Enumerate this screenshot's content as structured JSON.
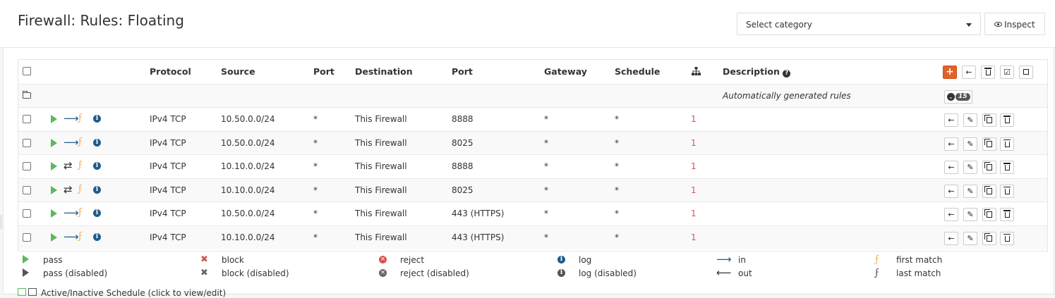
{
  "page": {
    "title": "Firewall: Rules: Floating"
  },
  "category_select": {
    "value": "Select category"
  },
  "inspect": {
    "label": "Inspect"
  },
  "columns": [
    "Protocol",
    "Source",
    "Port",
    "Destination",
    "Port",
    "Gateway",
    "Schedule",
    "Description"
  ],
  "auto_rules": {
    "description": "Automatically generated rules",
    "count": "15"
  },
  "rules": [
    {
      "direction": "in",
      "protocol": "IPv4 TCP",
      "source": "10.50.0.0/24",
      "src_port": "*",
      "destination": "This Firewall",
      "dst_port": "8888",
      "gateway": "*",
      "schedule": "*",
      "evaluations": "1",
      "description": ""
    },
    {
      "direction": "in",
      "protocol": "IPv4 TCP",
      "source": "10.50.0.0/24",
      "src_port": "*",
      "destination": "This Firewall",
      "dst_port": "8025",
      "gateway": "*",
      "schedule": "*",
      "evaluations": "1",
      "description": ""
    },
    {
      "direction": "both",
      "protocol": "IPv4 TCP",
      "source": "10.10.0.0/24",
      "src_port": "*",
      "destination": "This Firewall",
      "dst_port": "8888",
      "gateway": "*",
      "schedule": "*",
      "evaluations": "1",
      "description": ""
    },
    {
      "direction": "both",
      "protocol": "IPv4 TCP",
      "source": "10.10.0.0/24",
      "src_port": "*",
      "destination": "This Firewall",
      "dst_port": "8025",
      "gateway": "*",
      "schedule": "*",
      "evaluations": "1",
      "description": ""
    },
    {
      "direction": "in",
      "protocol": "IPv4 TCP",
      "source": "10.50.0.0/24",
      "src_port": "*",
      "destination": "This Firewall",
      "dst_port": "443 (HTTPS)",
      "gateway": "*",
      "schedule": "*",
      "evaluations": "1",
      "description": ""
    },
    {
      "direction": "in",
      "protocol": "IPv4 TCP",
      "source": "10.10.0.0/24",
      "src_port": "*",
      "destination": "This Firewall",
      "dst_port": "443 (HTTPS)",
      "gateway": "*",
      "schedule": "*",
      "evaluations": "1",
      "description": ""
    }
  ],
  "legend": {
    "pass": "pass",
    "pass_disabled": "pass (disabled)",
    "block": "block",
    "block_disabled": "block (disabled)",
    "reject": "reject",
    "reject_disabled": "reject (disabled)",
    "log": "log",
    "log_disabled": "log (disabled)",
    "in": "in",
    "out": "out",
    "first_match": "first match",
    "last_match": "last match"
  },
  "footer": {
    "schedule_note": "Active/Inactive Schedule (click to view/edit)"
  },
  "colors": {
    "accent": "#e0612a",
    "pass": "#5cb85c",
    "info": "#1f5c8c",
    "bolt": "#f0ad4e",
    "reject": "#d9534f"
  },
  "icons": [
    "play-icon",
    "arrow-right-icon",
    "arrows-swap-icon",
    "bolt-icon",
    "info-icon",
    "sitemap-icon",
    "plus-icon",
    "arrow-left-icon",
    "trash-icon",
    "check-square-icon",
    "square-icon",
    "pencil-icon",
    "copy-icon",
    "folder-icon",
    "chevron-down-icon",
    "eye-icon"
  ]
}
